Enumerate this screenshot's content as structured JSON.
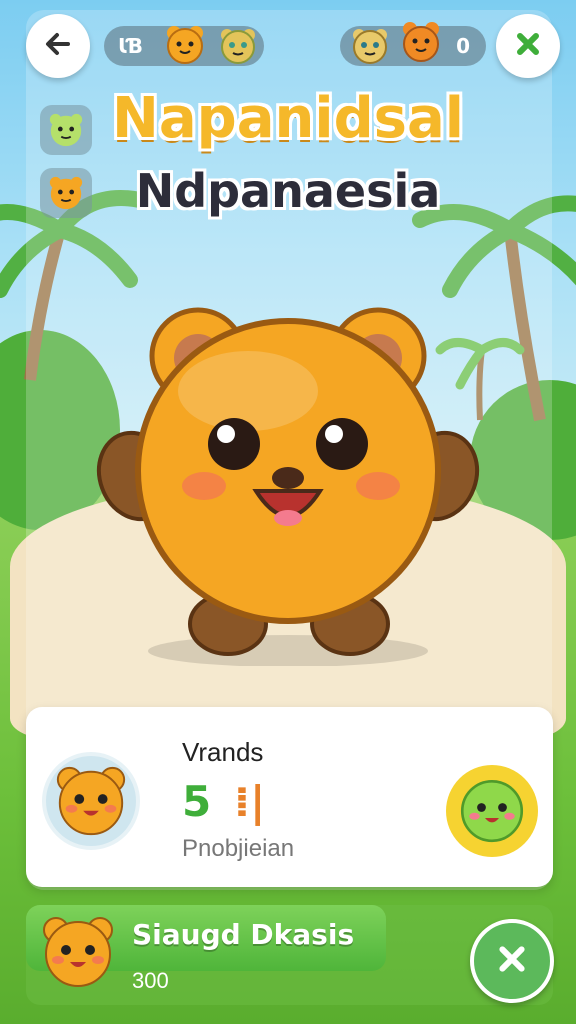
{
  "header": {
    "back_icon": "arrow-left-icon",
    "left_counter": "ꙆƁ",
    "right_counter": "0",
    "close_icon": "cross-icon"
  },
  "titles": {
    "primary": "Napanidsal",
    "secondary": "Ndpanaesia"
  },
  "info_card": {
    "title": "Vrands",
    "stat_value_a": "5",
    "stat_value_b": "⁞|",
    "subtitle": "Pnobjieian"
  },
  "bottom_bar": {
    "title": "Siaugd Dkasis",
    "amount": "300"
  },
  "colors": {
    "title_orange": "#f5b82a",
    "bear_orange": "#f5a623",
    "accent_green": "#3fae3a",
    "badge_yellow": "#f6d331"
  }
}
